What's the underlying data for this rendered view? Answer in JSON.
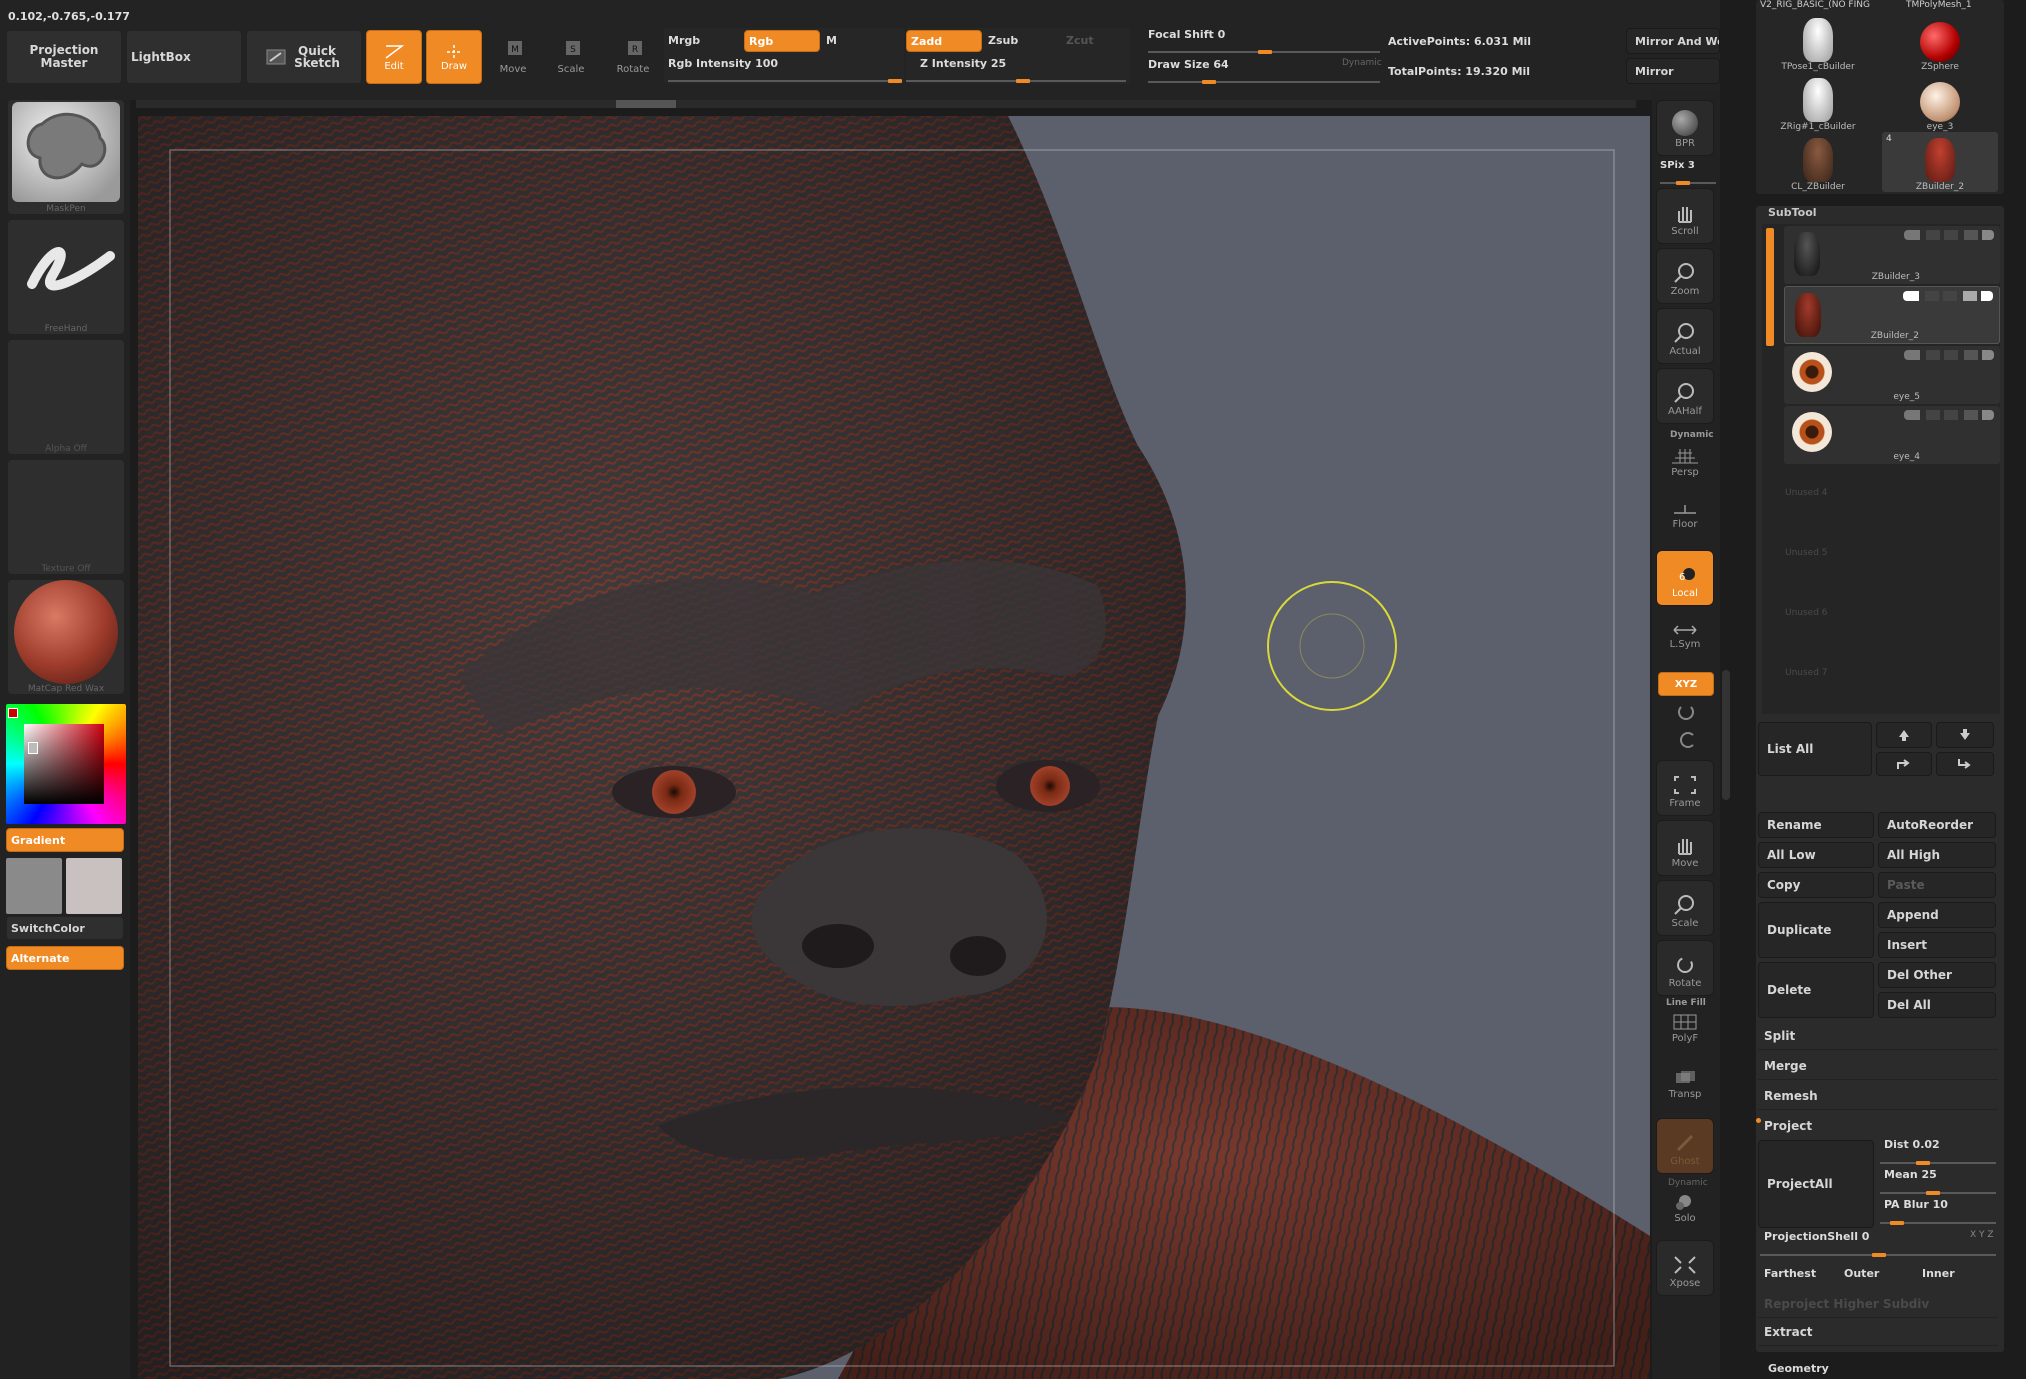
{
  "coords": "0.102,-0.765,-0.177",
  "top": {
    "projection_master": "Projection Master",
    "lightbox": "LightBox",
    "quick_sketch": "Quick Sketch",
    "edit": "Edit",
    "draw": "Draw",
    "move": "Move",
    "scale": "Scale",
    "rotate": "Rotate",
    "mrgb": "Mrgb",
    "rgb": "Rgb",
    "m": "M",
    "rgb_intensity": "Rgb Intensity 100",
    "zadd": "Zadd",
    "zsub": "Zsub",
    "zcut": "Zcut",
    "z_intensity": "Z Intensity 25",
    "focal_shift": "Focal Shift 0",
    "draw_size": "Draw Size 64",
    "dynamic": "Dynamic",
    "active_points": "ActivePoints: 6.031 Mil",
    "total_points": "TotalPoints: 19.320 Mil",
    "mirror_and_weld": "Mirror And We",
    "mirror": "Mirror"
  },
  "left": {
    "brush": "MaskPen",
    "stroke": "FreeHand",
    "alpha": "Alpha Off",
    "texture": "Texture Off",
    "material": "MatCap Red Wax",
    "gradient": "Gradient",
    "switch_color": "SwitchColor",
    "alternate": "Alternate"
  },
  "colors": {
    "accent": "#f08a24",
    "canvas_bg": "#5c5f6c",
    "skin_dark": "#3e3b3d",
    "skin_red": "#7a382c"
  },
  "right_tools": {
    "bpr": "BPR",
    "spix": "SPix 3",
    "scroll": "Scroll",
    "zoom": "Zoom",
    "actual": "Actual",
    "aahalf": "AAHalf",
    "dynamic": "Dynamic",
    "persp": "Persp",
    "floor": "Floor",
    "local": "Local",
    "lsym": "L.Sym",
    "xyz": "XYZ",
    "frame": "Frame",
    "move": "Move",
    "scale": "Scale",
    "rotate": "Rotate",
    "line_fill": "Line Fill",
    "polyf": "PolyF",
    "transp": "Transp",
    "ghost": "Ghost",
    "dynamic2": "Dynamic",
    "solo": "Solo",
    "xpose": "Xpose"
  },
  "tools_palette": {
    "header_left": "V2_RIG_BASIC_(NO FING",
    "header_right": "TMPolyMesh_1",
    "items": [
      {
        "label": "TPose1_cBuilder"
      },
      {
        "label": "ZSphere"
      },
      {
        "label": "ZRig#1_cBuilder"
      },
      {
        "label": "eye_3"
      },
      {
        "label": "CL_ZBuilder"
      },
      {
        "label": "ZBuilder_2"
      }
    ],
    "badge": "4"
  },
  "subtool": {
    "title": "SubTool",
    "rows": [
      {
        "name": "ZBuilder_3"
      },
      {
        "name": "ZBuilder_2"
      },
      {
        "name": "eye_5"
      },
      {
        "name": "eye_4"
      }
    ],
    "unused": [
      "Unused 4",
      "Unused 5",
      "Unused 6",
      "Unused 7"
    ],
    "list_all": "List All",
    "rename": "Rename",
    "auto_reorder": "AutoReorder",
    "all_low": "All Low",
    "all_high": "All High",
    "copy": "Copy",
    "paste": "Paste",
    "duplicate": "Duplicate",
    "append": "Append",
    "insert": "Insert",
    "delete": "Delete",
    "del_other": "Del Other",
    "del_all": "Del All",
    "split": "Split",
    "merge": "Merge",
    "remesh": "Remesh",
    "project": "Project",
    "project_all": "ProjectAll",
    "dist": "Dist 0.02",
    "mean": "Mean 25",
    "pa_blur": "PA Blur 10",
    "projection_shell": "ProjectionShell 0",
    "farthest": "Farthest",
    "outer": "Outer",
    "inner": "Inner",
    "reproject": "Reproject Higher Subdiv",
    "extract": "Extract",
    "geometry": "Geometry",
    "xyz_tag": "X Y Z"
  }
}
